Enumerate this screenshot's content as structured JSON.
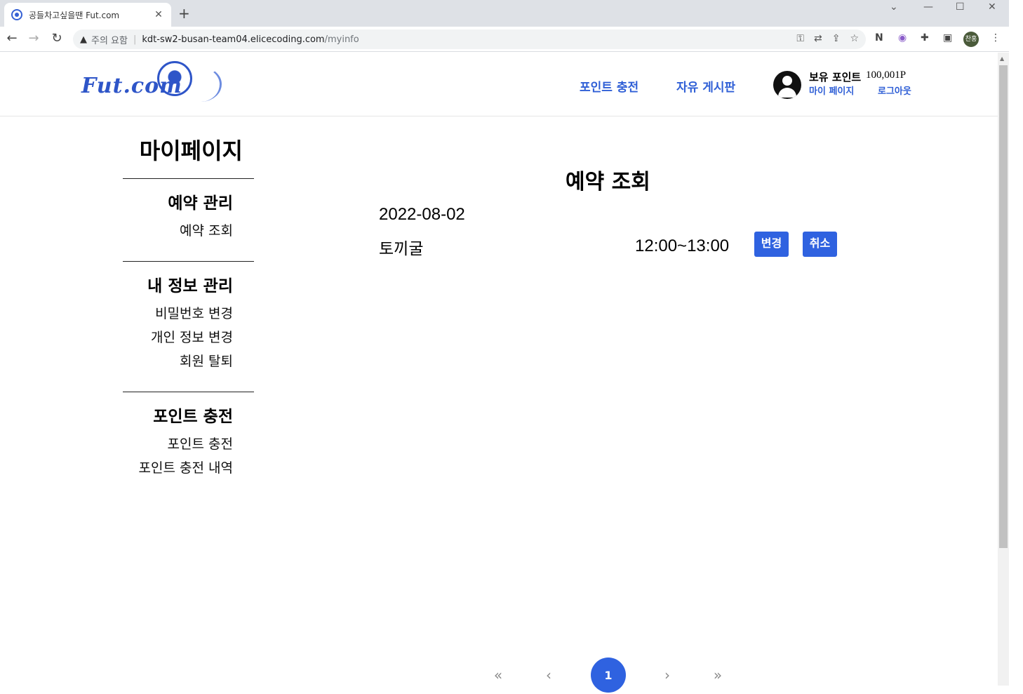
{
  "browser": {
    "tab_title": "공들차고싶을땐 Fut.com",
    "tab_close": "✕",
    "new_tab": "+",
    "security_warning": "주의 요함",
    "url_host": "kdt-sw2-busan-team04.elicecoding.com",
    "url_path": "/myinfo",
    "profile_initials": "찬홍"
  },
  "header": {
    "logo_text": "Fut.com",
    "nav": [
      {
        "label": "포인트 충전"
      },
      {
        "label": "자유 게시판"
      }
    ],
    "points_label": "보유 포인트",
    "points_value": "100,001P",
    "mypage_link": "마이 페이지",
    "logout_link": "로그아웃"
  },
  "sidebar": {
    "title": "마이페이지",
    "sections": [
      {
        "heading": "예약 관리",
        "items": [
          "예약 조회"
        ]
      },
      {
        "heading": "내 정보 관리",
        "items": [
          "비밀번호 변경",
          "개인 정보 변경",
          "회원 탈퇴"
        ]
      },
      {
        "heading": "포인트 충전",
        "items": [
          "포인트 충전",
          "포인트 충전 내역"
        ]
      }
    ]
  },
  "main": {
    "title": "예약 조회",
    "reservations": [
      {
        "date": "2022-08-02",
        "place": "토끼굴",
        "time": "12:00~13:00",
        "change_label": "변경",
        "cancel_label": "취소"
      }
    ]
  },
  "pagination": {
    "first": "«",
    "prev": "‹",
    "current": "1",
    "next": "›",
    "last": "»"
  },
  "colors": {
    "accent": "#2f62e0",
    "nav_text": "#2f5fd6"
  }
}
